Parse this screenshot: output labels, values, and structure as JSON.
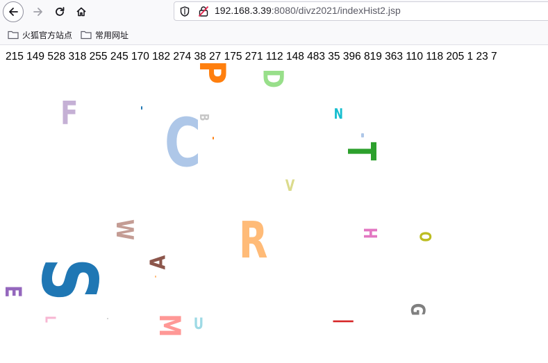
{
  "browser": {
    "url_host": "192.168.3.39",
    "url_rest": ":8080/divz2021/indexHist2.jsp",
    "bookmarks": [
      "火狐官方站点",
      "常用网址"
    ],
    "icons": [
      "back-arrow-icon",
      "forward-arrow-icon",
      "reload-icon",
      "home-icon",
      "shield-icon",
      "insecure-lock-icon",
      "folder-icon"
    ]
  },
  "page": {
    "numbers_text": "215 149 528 318 255 245 170 182 274 38 27 175 271 112 148 483 35 396 819 363 110 118 205 1 23 7",
    "letters": [
      {
        "char": "P",
        "color": "#ff7f0e"
      },
      {
        "char": "D",
        "color": "#98df8a"
      },
      {
        "char": "F",
        "color": "#c5b0d5"
      },
      {
        "char": "B",
        "color": "#c7c7c7"
      },
      {
        "char": "C",
        "color": "#aec7e8"
      },
      {
        "char": "N",
        "color": "#17becf"
      },
      {
        "char": "T",
        "color": "#2ca02c"
      },
      {
        "char": "V",
        "color": "#dbdb8d"
      },
      {
        "char": "W",
        "color": "#c49c94"
      },
      {
        "char": "R",
        "color": "#ffbb78"
      },
      {
        "char": "H",
        "color": "#e377c2"
      },
      {
        "char": "O",
        "color": "#bcbd22"
      },
      {
        "char": "A",
        "color": "#8c564b"
      },
      {
        "char": "S",
        "color": "#1f77b4"
      },
      {
        "char": "E",
        "color": "#9467bd"
      },
      {
        "char": "L",
        "color": "#f7b6d2"
      },
      {
        "char": "M",
        "color": "#ff9896"
      },
      {
        "char": "U",
        "color": "#9edae5"
      },
      {
        "char": "I",
        "color": "#d62728"
      },
      {
        "char": "G",
        "color": "#7f7f7f"
      }
    ]
  }
}
